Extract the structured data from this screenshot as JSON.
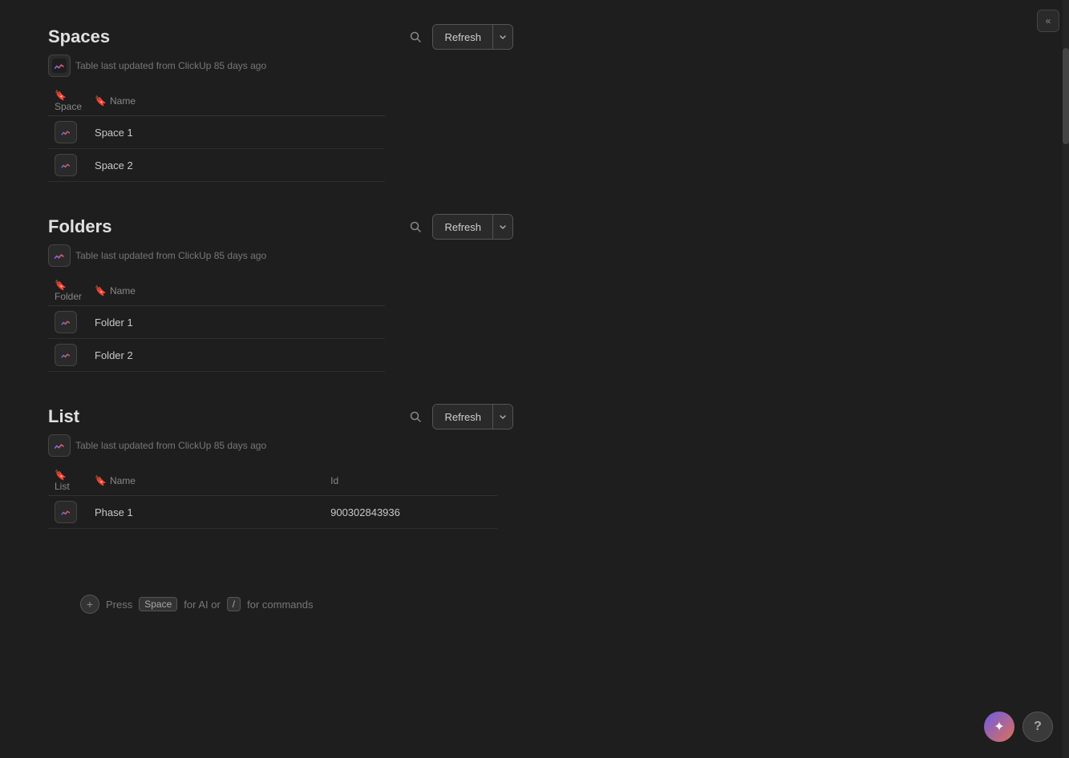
{
  "collapse_button": "«",
  "spaces": {
    "title": "Spaces",
    "update_info": "Table last updated from ClickUp 85 days ago",
    "refresh_label": "Refresh",
    "columns": [
      {
        "key": "space",
        "label": "Space",
        "icon": "bookmark-icon"
      },
      {
        "key": "name",
        "label": "Name",
        "icon": "bookmark-icon"
      }
    ],
    "rows": [
      {
        "name": "Space 1"
      },
      {
        "name": "Space 2"
      }
    ]
  },
  "folders": {
    "title": "Folders",
    "update_info": "Table last updated from ClickUp 85 days ago",
    "refresh_label": "Refresh",
    "columns": [
      {
        "key": "folder",
        "label": "Folder",
        "icon": "bookmark-icon"
      },
      {
        "key": "name",
        "label": "Name",
        "icon": "bookmark-icon"
      }
    ],
    "rows": [
      {
        "name": "Folder 1"
      },
      {
        "name": "Folder 2"
      }
    ]
  },
  "list": {
    "title": "List",
    "update_info": "Table last updated from ClickUp 85 days ago",
    "refresh_label": "Refresh",
    "columns": [
      {
        "key": "list",
        "label": "List",
        "icon": "bookmark-icon"
      },
      {
        "key": "name",
        "label": "Name",
        "icon": "bookmark-icon"
      },
      {
        "key": "id",
        "label": "Id",
        "icon": null
      }
    ],
    "rows": [
      {
        "name": "Phase 1",
        "id": "900302843936"
      }
    ]
  },
  "bottom_bar": {
    "press_label": "Press",
    "space_key": "Space",
    "for_ai": "for AI or",
    "slash_key": "/",
    "for_commands": "for commands"
  },
  "buttons": {
    "sparkle": "✦",
    "help": "?"
  },
  "icons": {
    "search": "🔍",
    "chevron_down": "▾",
    "bookmark": "🔖"
  }
}
